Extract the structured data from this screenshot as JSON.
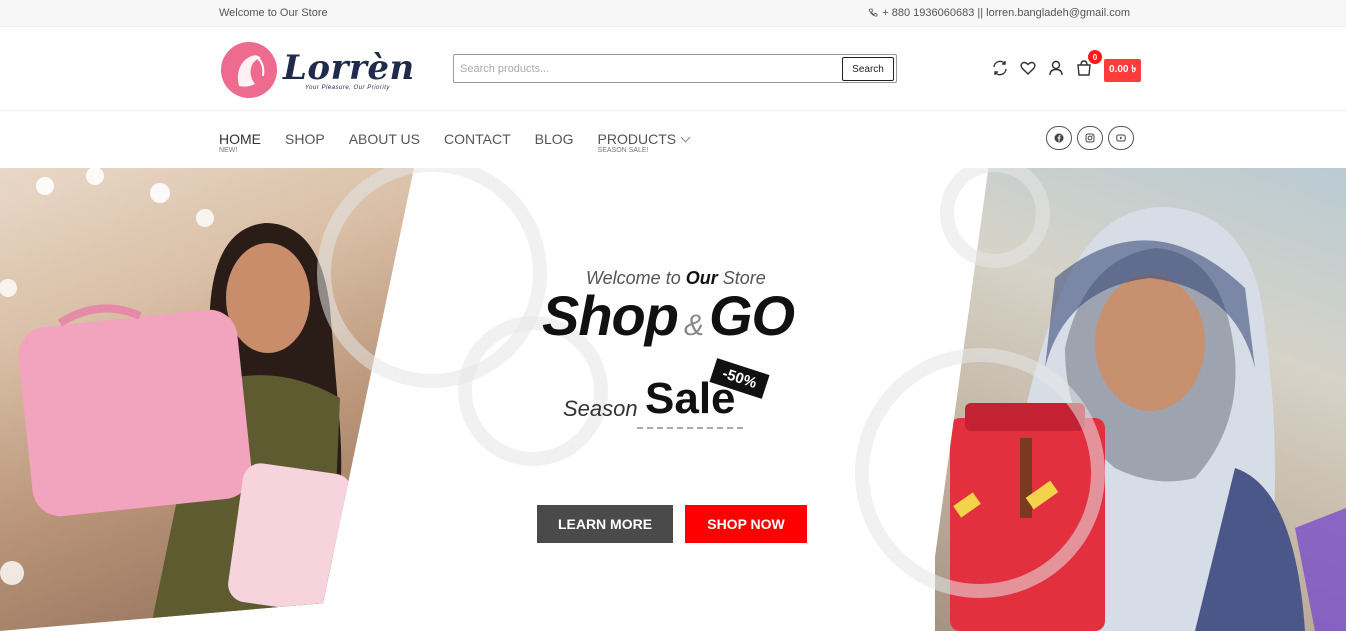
{
  "topbar": {
    "welcome": "Welcome to Our Store",
    "contact": "+ 880 1936060683 || lorren.bangladeh@gmail.com"
  },
  "header": {
    "logo_text": "Lorrèn",
    "logo_tagline": "Your Pleasure, Our Priority",
    "search_placeholder": "Search products...",
    "search_button": "Search",
    "cart_count": "0",
    "cart_total": "0.00 ৳"
  },
  "nav": {
    "items": [
      {
        "label": "HOME",
        "sub": "NEW!"
      },
      {
        "label": "SHOP",
        "sub": ""
      },
      {
        "label": "ABOUT US",
        "sub": ""
      },
      {
        "label": "CONTACT",
        "sub": ""
      },
      {
        "label": "BLOG",
        "sub": ""
      },
      {
        "label": "PRODUCTS",
        "sub": "SEASON SALE!"
      }
    ],
    "socials": [
      "facebook-icon",
      "instagram-icon",
      "youtube-icon"
    ]
  },
  "hero": {
    "welcome_prefix": "Welcome to ",
    "welcome_bold": "Our",
    "welcome_suffix": " Store",
    "title_left": "Shop",
    "title_amp": "&",
    "title_right": "GO",
    "season": "Season",
    "sale": "Sale",
    "discount": "-50%",
    "learn_more": "LEARN MORE",
    "shop_now": "SHOP NOW"
  },
  "colors": {
    "accent": "#ff0000",
    "cart_badge": "#ff3b3b",
    "logo_pink": "#ee6a8e",
    "logo_navy": "#1f2a4c"
  }
}
